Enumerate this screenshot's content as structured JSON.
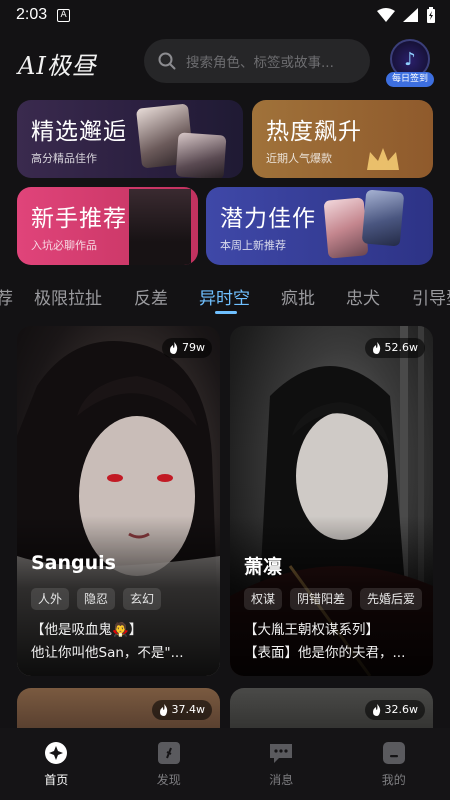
{
  "status_bar": {
    "time": "2:03",
    "badge": "A"
  },
  "header": {
    "logo": "AI极昼",
    "search_placeholder": "搜索角色、标签或故事...",
    "sign_in_label": "每日签到"
  },
  "categories": [
    {
      "title": "精选邂逅",
      "subtitle": "高分精品佳作",
      "color": "#3a2a4e"
    },
    {
      "title": "热度飙升",
      "subtitle": "近期人气爆款",
      "color": "#a0723a"
    },
    {
      "title": "新手推荐",
      "subtitle": "入坑必聊作品",
      "color": "#e0447a"
    },
    {
      "title": "潜力佳作",
      "subtitle": "本周上新推荐",
      "color": "#3f48a8"
    }
  ],
  "tabs": {
    "items": [
      "荐",
      "极限拉扯",
      "反差",
      "异时空",
      "疯批",
      "忠犬",
      "引导型"
    ],
    "active_index": 3,
    "active_color": "#6fc0ff"
  },
  "feed": [
    {
      "name": "Sanguis",
      "heat": "79w",
      "tags": [
        "人外",
        "隐忍",
        "玄幻"
      ],
      "desc_line1": "【他是吸血鬼🧛】",
      "desc_line2": "他让你叫他San，不是\"..."
    },
    {
      "name": "萧凛",
      "heat": "52.6w",
      "tags": [
        "权谋",
        "阴错阳差",
        "先婚后爱"
      ],
      "desc_line1": "【大胤王朝权谋系列】",
      "desc_line2": "【表面】他是你的夫君，..."
    },
    {
      "heat": "37.4w"
    },
    {
      "heat": "32.6w"
    }
  ],
  "bottom_nav": {
    "items": [
      {
        "label": "首页",
        "icon": "home-icon"
      },
      {
        "label": "发现",
        "icon": "discover-icon"
      },
      {
        "label": "消息",
        "icon": "message-icon"
      },
      {
        "label": "我的",
        "icon": "profile-icon"
      }
    ],
    "active_index": 0
  }
}
